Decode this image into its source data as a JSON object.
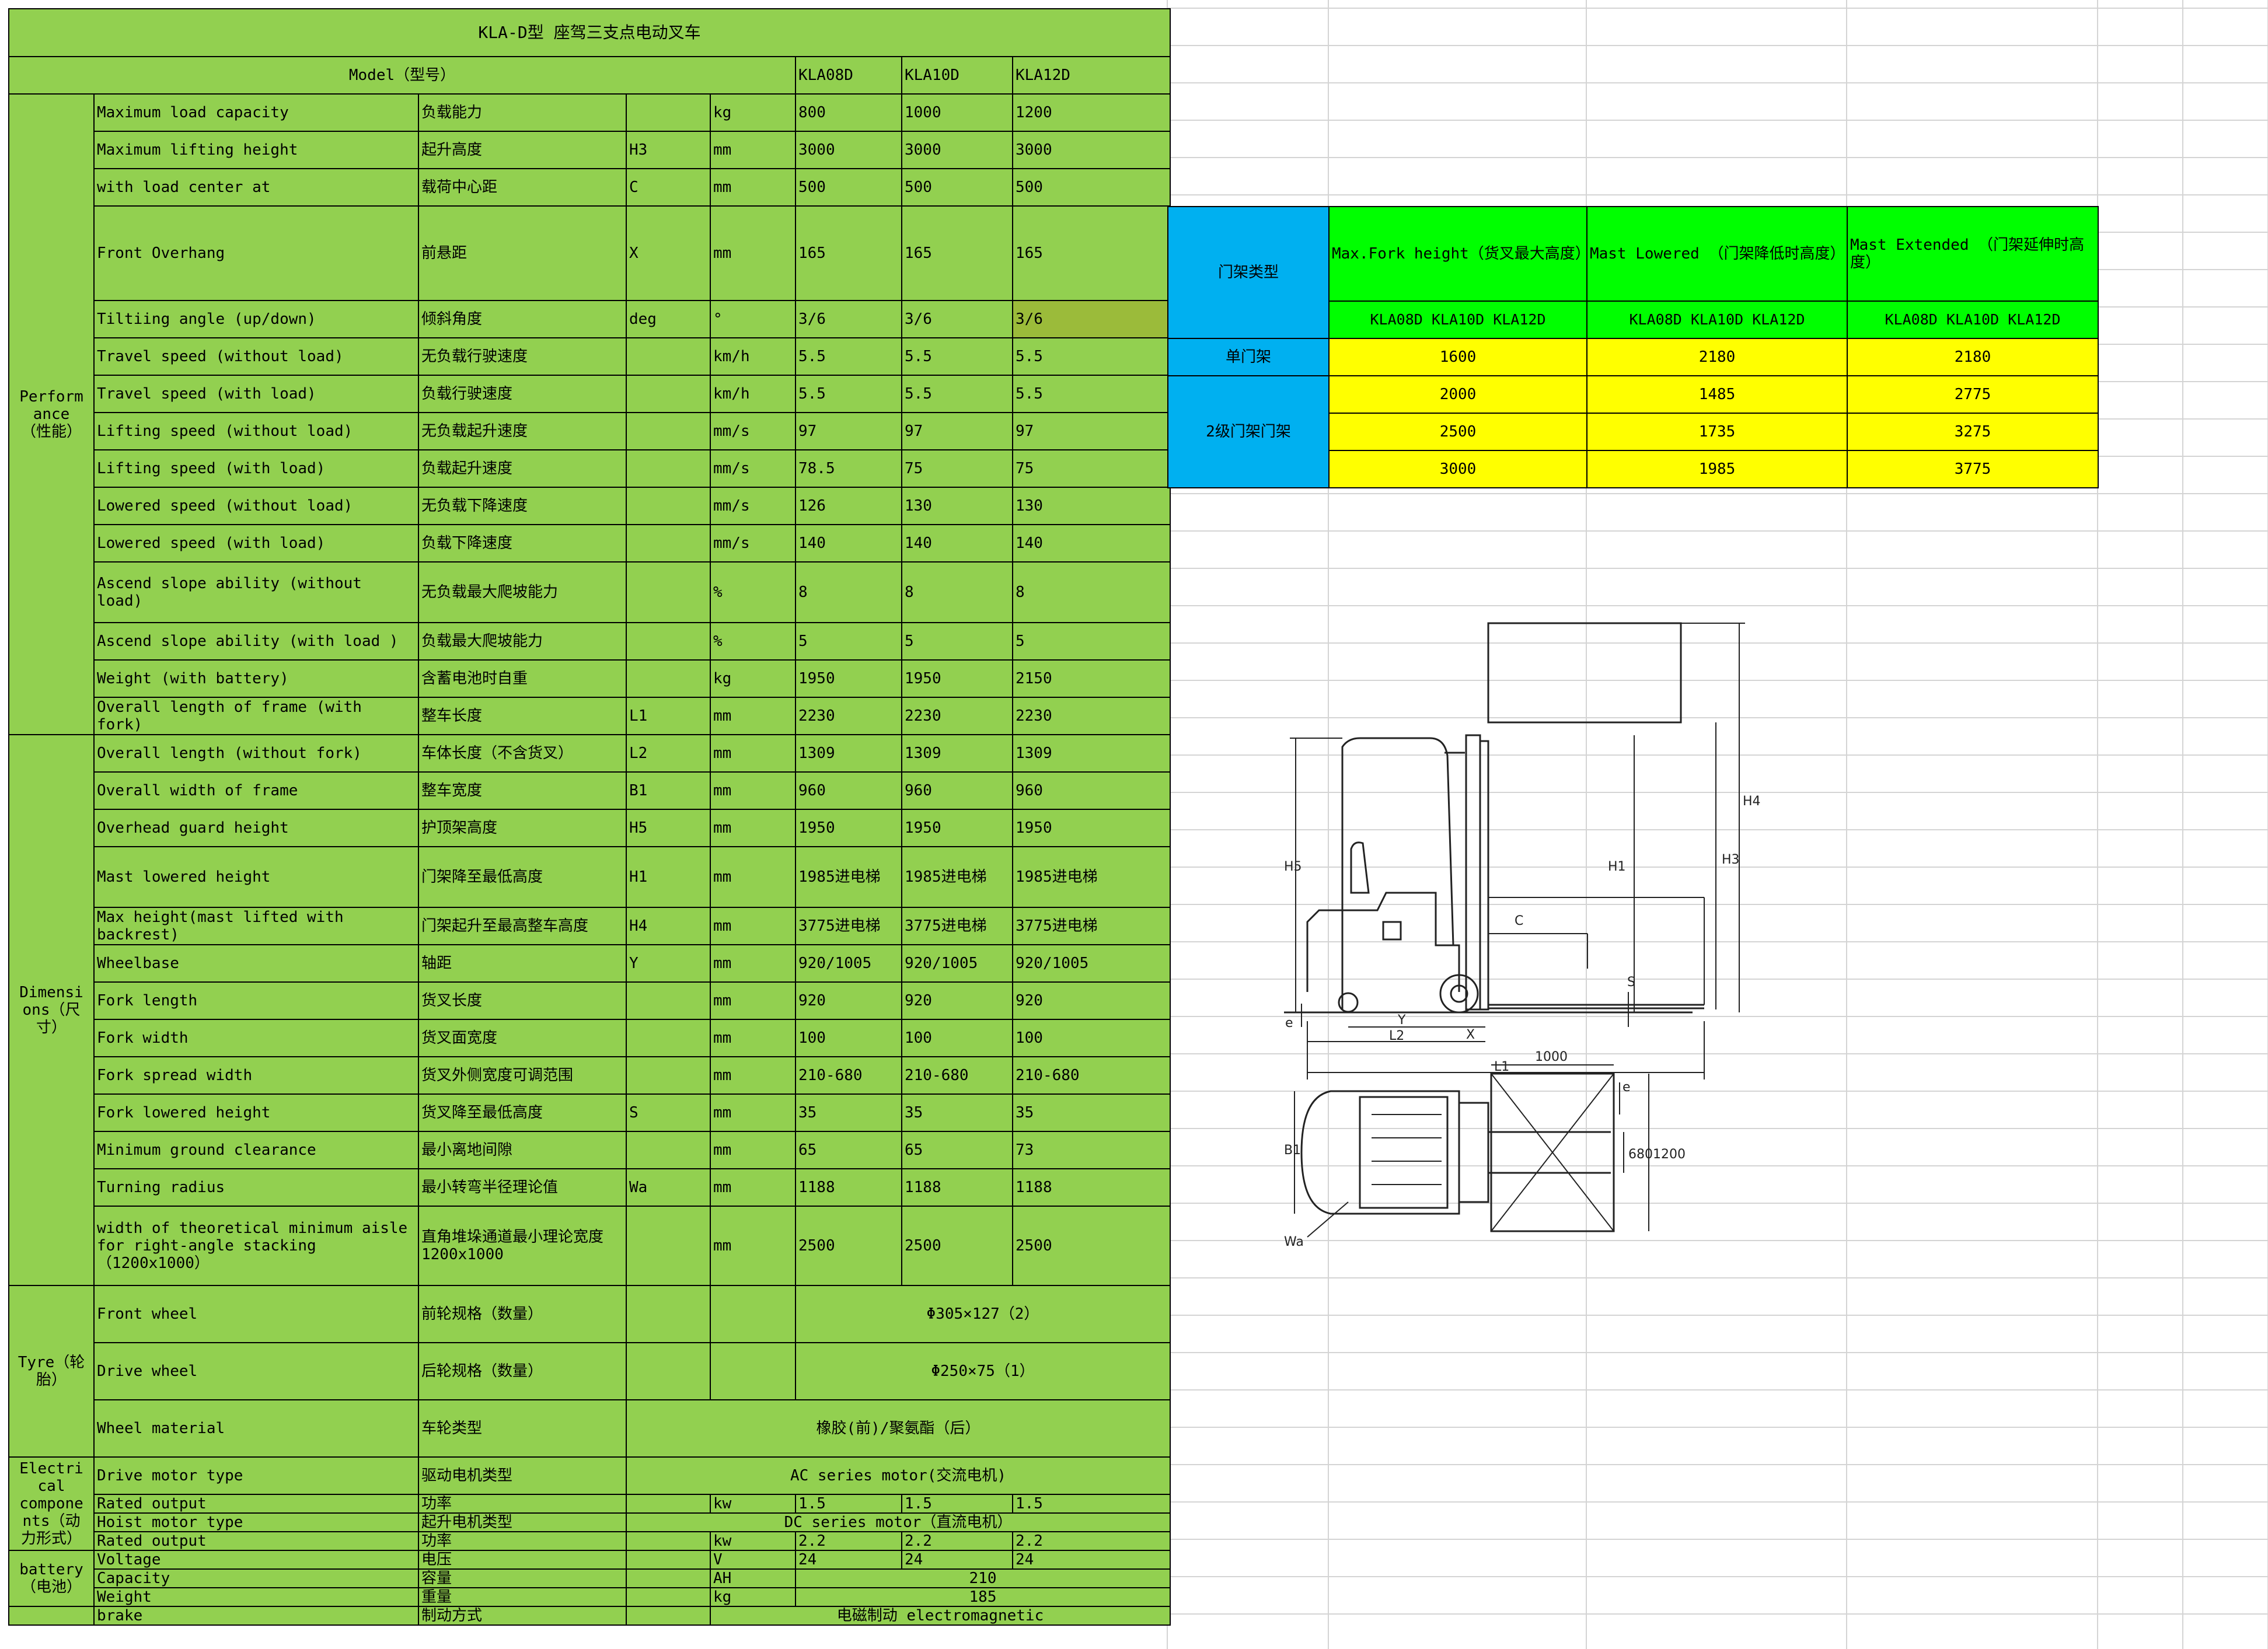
{
  "title": "KLA-D型 座驾三支点电动叉车",
  "model_label": "Model（型号）",
  "models": [
    "KLA08D",
    "KLA10D",
    "KLA12D"
  ],
  "sections": [
    {
      "name": "Perform\nance\n（性能）",
      "rows": [
        {
          "en": "Maximum load capacity",
          "cn": "负载能力",
          "code": "",
          "unit": "kg",
          "v": [
            "800",
            "1000",
            "1200"
          ],
          "h": 64
        },
        {
          "en": "Maximum lifting height",
          "cn": "起升高度",
          "code": "H3",
          "unit": "mm",
          "v": [
            "3000",
            "3000",
            "3000"
          ],
          "h": 64
        },
        {
          "en": "with load center at",
          "cn": "载荷中心距",
          "code": "C",
          "unit": "mm",
          "v": [
            "500",
            "500",
            "500"
          ],
          "h": 64
        },
        {
          "en": "Front Overhang",
          "cn": "前悬距",
          "code": "X",
          "unit": "mm",
          "v": [
            "165",
            "165",
            "165"
          ],
          "h": 162
        },
        {
          "en": " Tiltiing angle (up/down)",
          "cn": "倾斜角度",
          "code": "deg",
          "unit": "°",
          "v": [
            "3/6",
            "3/6",
            "3/6"
          ],
          "h": 64,
          "hl": 2
        },
        {
          "en": "Travel speed (without load)",
          "cn": "无负载行驶速度",
          "code": "",
          "unit": "km/h",
          "v": [
            "5.5",
            "5.5",
            "5.5"
          ],
          "h": 64
        },
        {
          "en": "Travel speed (with load)",
          "cn": "负载行驶速度",
          "code": "",
          "unit": "km/h",
          "v": [
            "5.5",
            "5.5",
            "5.5"
          ],
          "h": 64
        },
        {
          "en": "Lifting speed (without load)",
          "cn": "无负载起升速度",
          "code": "",
          "unit": "mm/s",
          "v": [
            "97",
            "97",
            "97"
          ],
          "h": 64
        },
        {
          "en": "Lifting speed (with load)",
          "cn": "负载起升速度",
          "code": "",
          "unit": "mm/s",
          "v": [
            "78.5",
            "75",
            "75"
          ],
          "h": 64
        },
        {
          "en": "Lowered speed (without load)",
          "cn": "无负载下降速度",
          "code": "",
          "unit": "mm/s",
          "v": [
            "126",
            "130",
            "130"
          ],
          "h": 64
        },
        {
          "en": "Lowered speed (with load)",
          "cn": "负载下降速度",
          "code": "",
          "unit": "mm/s",
          "v": [
            "140",
            "140",
            "140"
          ],
          "h": 64
        },
        {
          "en": "Ascend slope ability (without load)",
          "cn": "无负载最大爬坡能力",
          "code": "",
          "unit": "%",
          "v": [
            "8",
            "8",
            "8"
          ],
          "h": 104
        },
        {
          "en": "Ascend slope ability (with load )",
          "cn": "负载最大爬坡能力",
          "code": "",
          "unit": "%",
          "v": [
            "5",
            "5",
            "5"
          ],
          "h": 64
        },
        {
          "en": "Weight (with battery)",
          "cn": "含蓄电池时自重",
          "code": "",
          "unit": "kg",
          "v": [
            "1950",
            "1950",
            "2150"
          ],
          "h": 64
        },
        {
          "en": "Overall length of frame  (with fork)",
          "cn": "整车长度",
          "code": "L1",
          "unit": "mm",
          "v": [
            "2230",
            "2230",
            "2230"
          ],
          "h": 64
        }
      ]
    },
    {
      "name": "Dimensi\nons（尺\n寸）",
      "rows": [
        {
          "en": "Overall length  (without fork)",
          "cn": "车体长度（不含货叉）",
          "code": "L2",
          "unit": "mm",
          "v": [
            "1309",
            "1309",
            "1309"
          ],
          "h": 64
        },
        {
          "en": "Overall width of frame",
          "cn": "整车宽度",
          "code": "B1",
          "unit": "mm",
          "v": [
            "960",
            "960",
            "960"
          ],
          "h": 64
        },
        {
          "en": "Overhead guard height",
          "cn": "护顶架高度",
          "code": "H5",
          "unit": "mm",
          "v": [
            "1950",
            "1950",
            "1950"
          ],
          "h": 64
        },
        {
          "en": "Mast lowered height",
          "cn": "门架降至最低高度",
          "code": "H1",
          "unit": "mm",
          "v": [
            "1985进电梯",
            "1985进电梯",
            "1985进电梯"
          ],
          "h": 104
        },
        {
          "en": "Max height(mast lifted with backrest)",
          "cn": "门架起升至最高整车高度",
          "code": "H4",
          "unit": "mm",
          "v": [
            "3775进电梯",
            "3775进电梯",
            "3775进电梯"
          ],
          "h": 64
        },
        {
          "en": "Wheelbase",
          "cn": "轴距",
          "code": "Y",
          "unit": "mm",
          "v": [
            "920/1005",
            "920/1005",
            "920/1005"
          ],
          "h": 64
        },
        {
          "en": "Fork length",
          "cn": "货叉长度",
          "code": "",
          "unit": "mm",
          "v": [
            "920",
            "920",
            "920"
          ],
          "h": 64
        },
        {
          "en": "Fork width",
          "cn": "货叉面宽度",
          "code": "",
          "unit": "mm",
          "v": [
            "100",
            "100",
            "100"
          ],
          "h": 64
        },
        {
          "en": "Fork spread width",
          "cn": "货叉外侧宽度可调范围",
          "code": "",
          "unit": "mm",
          "v": [
            "210-680",
            "210-680",
            "210-680"
          ],
          "h": 64
        },
        {
          "en": "Fork lowered height",
          "cn": "货叉降至最低高度",
          "code": "S",
          "unit": "mm",
          "v": [
            "35",
            "35",
            "35"
          ],
          "h": 64
        },
        {
          "en": "Minimum ground clearance",
          "cn": "最小离地间隙",
          "code": "",
          "unit": "mm",
          "v": [
            "65",
            "65",
            "73"
          ],
          "h": 64
        },
        {
          "en": "Turning radius",
          "cn": "最小转弯半径理论值",
          "code": "Wa",
          "unit": "mm",
          "v": [
            "1188",
            "1188",
            "1188"
          ],
          "h": 64
        },
        {
          "en": "width of theoretical  minimum aisle for right-angle  stacking （1200x1000）",
          "cn": "直角堆垛通道最小理论宽度 1200x1000",
          "code": "",
          "unit": "mm",
          "v": [
            "2500",
            "2500",
            "2500"
          ],
          "h": 136
        }
      ]
    },
    {
      "name": "Tyre（轮\n胎）",
      "rows": [
        {
          "en": "Front wheel",
          "cn": "前轮规格（数量）",
          "code": "",
          "unit": "",
          "merged": "Φ305×127（2）",
          "span": "vals",
          "h": 98
        },
        {
          "en": "Drive wheel",
          "cn": "后轮规格（数量）",
          "code": "",
          "unit": "",
          "merged": "Φ250×75（1）",
          "span": "vals",
          "h": 98
        },
        {
          "en": "Wheel material",
          "cn": "车轮类型",
          "code": "",
          "unit": "",
          "merged": "橡胶(前)/聚氨酯（后）",
          "span": "code",
          "h": 98
        }
      ]
    },
    {
      "name": "Electri\ncal\ncompone\nnts（动\n力形式）",
      "rows": [
        {
          "en": "Drive motor type",
          "cn": "驱动电机类型",
          "code": "",
          "unit": "",
          "merged": "AC series motor(交流电机)",
          "span": "code",
          "h": 64
        },
        {
          "en": "Rated output",
          "cn": "功率",
          "code": "",
          "unit": "kw",
          "v": [
            "1.5",
            "1.5",
            "1.5"
          ],
          "h": 22
        },
        {
          "en": "Hoist motor type",
          "cn": "起升电机类型",
          "code": "",
          "unit": "",
          "merged": "DC series motor（直流电机）",
          "span": "code",
          "h": 22
        },
        {
          "en": "Rated output",
          "cn": "功率",
          "code": "",
          "unit": "kw",
          "v": [
            "2.2",
            "2.2",
            "2.2"
          ],
          "h": 22
        }
      ]
    },
    {
      "name": "battery\n（电池）",
      "rows": [
        {
          "en": "Voltage",
          "cn": "电压",
          "code": "",
          "unit": "V",
          "v": [
            "24",
            "24",
            "24"
          ],
          "h": 22
        },
        {
          "en": "Capacity",
          "cn": "容量",
          "code": "",
          "unit": "AH",
          "merged": "210",
          "span": "vals",
          "h": 22
        },
        {
          "en": "Weight",
          "cn": "重量",
          "code": "",
          "unit": "kg",
          "merged": "185",
          "span": "vals",
          "h": 22
        }
      ]
    },
    {
      "name": "",
      "rows": [
        {
          "en": "brake",
          "cn": "制动方式",
          "code": "",
          "unit": "",
          "merged": "电磁制动 electromagnetic",
          "span": "unit",
          "h": 22
        }
      ]
    }
  ],
  "mast_table": {
    "type_label": "门架类型",
    "headers": [
      "Max.Fork height（货叉最大高度）",
      "Mast Lowered     （门架降低时高度）",
      "Mast Extended  （门架延伸时高度）"
    ],
    "sub_models": "KLA08D   KLA10D   KLA12D",
    "groups": [
      {
        "label": "单门架",
        "rows": [
          [
            "1600",
            "2180",
            "2180"
          ]
        ]
      },
      {
        "label": "2级门架门架",
        "rows": [
          [
            "2000",
            "1485",
            "2775"
          ],
          [
            "2500",
            "1735",
            "3275"
          ],
          [
            "3000",
            "1985",
            "3775"
          ]
        ]
      }
    ]
  },
  "diagram_labels": {
    "h5": "H5",
    "h1": "H1",
    "h3": "H3",
    "h4": "H4",
    "c": "C",
    "s": "S",
    "y": "Y",
    "x": "X",
    "l2": "L2",
    "l1": "L1",
    "e3": "e",
    "w1000": "1000",
    "b1": "B1",
    "d680": "680",
    "d1200": "1200",
    "e": "e",
    "wa": "Wa"
  },
  "colors": {
    "spec_bg": "#92d050",
    "mast_cyan": "#00b0f0",
    "mast_green": "#00ff00",
    "mast_yellow": "#ffff00",
    "highlight": "#9bbb3a"
  }
}
